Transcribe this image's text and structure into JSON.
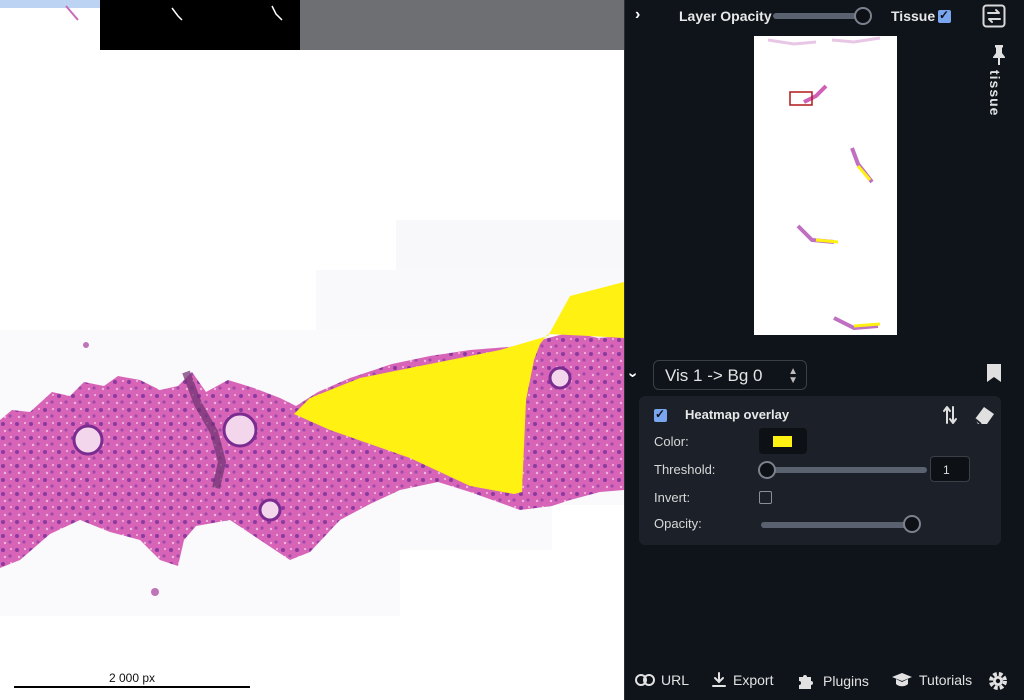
{
  "viewer": {
    "scale_label": "2 000 px",
    "overlay_color": "#fff212"
  },
  "panel": {
    "layer_opacity_label": "Layer Opacity",
    "layer_opacity_value": 1.0,
    "tissue_label": "Tissue",
    "tissue_checked": true,
    "pinned_tab_label": "tissue",
    "visualization_select": "Vis 1 -> Bg 0",
    "heatmap": {
      "enabled": true,
      "title": "Heatmap overlay",
      "color_label": "Color:",
      "color_value": "#fff212",
      "threshold_label": "Threshold:",
      "threshold_value": "1",
      "threshold_slider": 0.0,
      "invert_label": "Invert:",
      "invert_checked": false,
      "opacity_label": "Opacity:",
      "opacity_slider": 1.0
    },
    "bottom": {
      "url_label": "URL",
      "export_label": "Export",
      "plugins_label": "Plugins",
      "tutorials_label": "Tutorials"
    }
  }
}
